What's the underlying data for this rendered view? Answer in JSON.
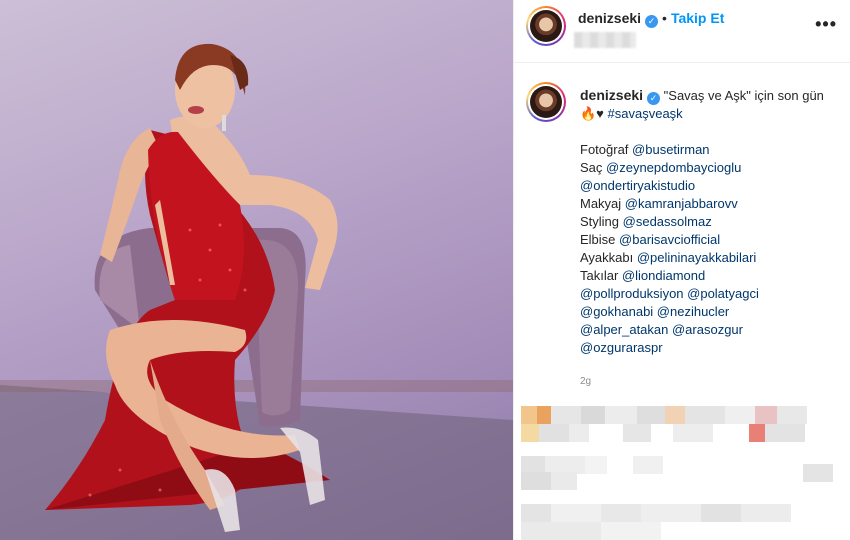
{
  "post": {
    "username": "denizseki",
    "follow_label": "Takip Et",
    "more_label": "•••",
    "caption_line": "\"Savaş ve Aşk\" için son gün",
    "caption_emoji": "🔥♥",
    "hashtag": "#savaşveaşk",
    "credits": [
      {
        "label": "Fotoğraf",
        "tags": "@busetirman"
      },
      {
        "label": "Saç",
        "tags": "@zeynepdombaycioglu"
      },
      {
        "label": "",
        "tags": "@ondertiryakistudio"
      },
      {
        "label": "Makyaj",
        "tags": "@kamranjabbarovv"
      },
      {
        "label": "Styling",
        "tags": "@sedassolmaz"
      },
      {
        "label": "Elbise",
        "tags": "@barisavciofficial"
      },
      {
        "label": "Ayakkabı",
        "tags": "@pelininayakkabilari"
      },
      {
        "label": "Takılar",
        "tags": "@liondiamond"
      },
      {
        "label": "",
        "tags": "@pollproduksiyon @polatyagci"
      },
      {
        "label": "",
        "tags": "@gokhanabi @nezihucler"
      },
      {
        "label": "",
        "tags": "@alper_atakan @arasozgur"
      },
      {
        "label": "",
        "tags": "@ozguraraspr"
      }
    ],
    "age": "2g"
  },
  "colors": {
    "link": "#00376b",
    "follow": "#0095f6",
    "verified": "#3897f0",
    "dress": "#b0111a"
  },
  "icons": {
    "verified": "verified-badge-icon",
    "more": "more-options-icon"
  }
}
